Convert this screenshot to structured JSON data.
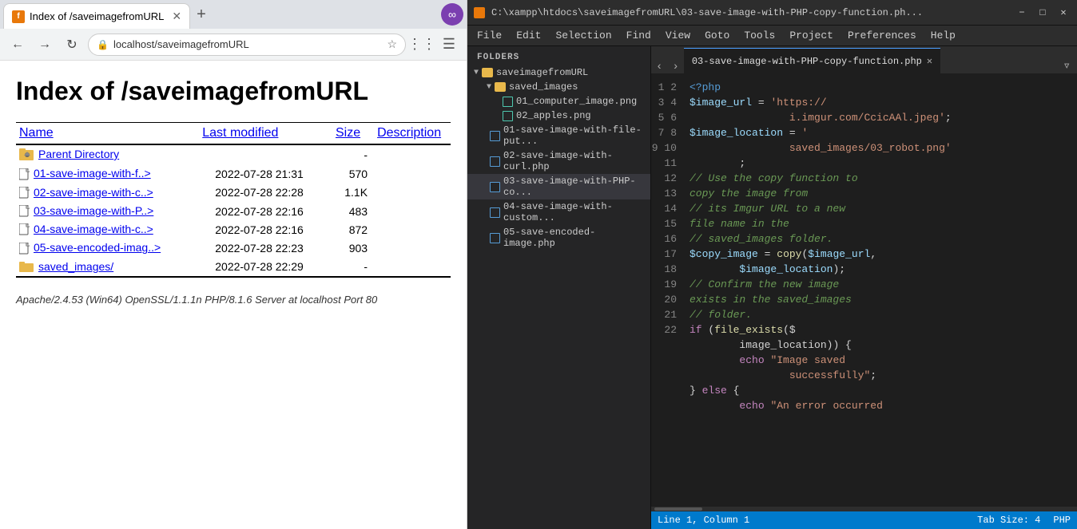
{
  "browser": {
    "tab_label": "Index of /saveimagefromURL",
    "favicon_letter": "f",
    "address": "localhost/saveimagefromURL",
    "page_title": "Index of /saveimagefromURL",
    "columns": {
      "name": "Name",
      "last_modified": "Last modified",
      "size": "Size",
      "description": "Description"
    },
    "entries": [
      {
        "name": "Parent Directory",
        "href": "#",
        "modified": "",
        "size": "-",
        "type": "parent"
      },
      {
        "name": "01-save-image-with-f..>",
        "href": "#",
        "modified": "2022-07-28 21:31",
        "size": "570",
        "type": "file"
      },
      {
        "name": "02-save-image-with-c..>",
        "href": "#",
        "modified": "2022-07-28 22:28",
        "size": "1.1K",
        "type": "file"
      },
      {
        "name": "03-save-image-with-P..>",
        "href": "#",
        "modified": "2022-07-28 22:16",
        "size": "483",
        "type": "file"
      },
      {
        "name": "04-save-image-with-c..>",
        "href": "#",
        "modified": "2022-07-28 22:16",
        "size": "872",
        "type": "file"
      },
      {
        "name": "05-save-encoded-imag..>",
        "href": "#",
        "modified": "2022-07-28 22:23",
        "size": "903",
        "type": "file"
      },
      {
        "name": "saved_images/",
        "href": "#",
        "modified": "2022-07-28 22:29",
        "size": "-",
        "type": "folder"
      }
    ],
    "footer": "Apache/2.4.53 (Win64) OpenSSL/1.1.1n PHP/8.1.6 Server at localhost Port 80"
  },
  "editor": {
    "titlebar": "C:\\xampp\\htdocs\\saveimagefromURL\\03-save-image-with-PHP-copy-function.ph...",
    "menus": [
      "File",
      "Edit",
      "Selection",
      "Find",
      "View",
      "Goto",
      "Tools",
      "Project",
      "Preferences",
      "Help"
    ],
    "folders_label": "FOLDERS",
    "tree": {
      "root": "saveimagefromURL",
      "subfolders": [
        {
          "name": "saved_images",
          "children": [
            {
              "name": "01_computer_image.png",
              "type": "image"
            },
            {
              "name": "02_apples.png",
              "type": "image"
            }
          ]
        }
      ],
      "files": [
        {
          "name": "01-save-image-with-file-put...",
          "type": "file",
          "active": false
        },
        {
          "name": "02-save-image-with-curl.php",
          "type": "file",
          "active": false
        },
        {
          "name": "03-save-image-with-PHP-co...",
          "type": "file",
          "active": true
        },
        {
          "name": "04-save-image-with-custom...",
          "type": "file",
          "active": false
        },
        {
          "name": "05-save-encoded-image.php",
          "type": "file",
          "active": false
        }
      ]
    },
    "active_tab": "03-save-image-with-PHP-copy-function.php",
    "statusbar": {
      "left": "Line 1, Column 1",
      "right": "Tab Size: 4",
      "language": "PHP"
    },
    "code_lines": [
      {
        "n": 1,
        "html": "<span class='tag'>&lt;?php</span>"
      },
      {
        "n": 2,
        "html": "<span class='var'>$image_url</span> <span class='op'>=</span> <span class='str'>'https://</span>"
      },
      {
        "n": 3,
        "html": "        <span class='str'>        i.imgur.com/CcicAAl.jpeg'</span><span class='op'>;</span>"
      },
      {
        "n": 4,
        "html": "<span class='var'>$image_location</span> <span class='op'>=</span> <span class='str'>'</span>"
      },
      {
        "n": 5,
        "html": "        <span class='str'>        saved_images/03_robot.png'</span>"
      },
      {
        "n": 6,
        "html": "        <span class='op'>;</span>"
      },
      {
        "n": 7,
        "html": "<span class='cm'>// Use the copy function to</span>"
      },
      {
        "n": 8,
        "html": "<span class='cm'>copy the image from</span>"
      },
      {
        "n": 9,
        "html": "<span class='cm'>// its Imgur URL to a new</span>"
      },
      {
        "n": 10,
        "html": "<span class='cm'>file name in the</span>"
      },
      {
        "n": 11,
        "html": "<span class='cm'>// saved_images folder.</span>"
      },
      {
        "n": 12,
        "html": "<span class='var'>$copy_image</span> <span class='op'>=</span> <span class='fn'>copy</span><span class='op'>(</span><span class='var'>$image_url</span><span class='op'>,</span>"
      },
      {
        "n": 13,
        "html": "        <span class='var'>$image_location</span><span class='op'>);</span>"
      },
      {
        "n": 14,
        "html": "<span class='cm'>// Confirm the new image</span>"
      },
      {
        "n": 15,
        "html": "<span class='cm'>exists in the saved_images</span>"
      },
      {
        "n": 16,
        "html": "<span class='cm'>// folder.</span>"
      },
      {
        "n": 17,
        "html": "<span class='kw'>if</span> <span class='op'>(</span><span class='fn'>file_exists</span><span class='op'>($</span>"
      },
      {
        "n": 18,
        "html": "        <span class='plain'>image_location)) {</span>"
      },
      {
        "n": 19,
        "html": "        <span class='kw'>echo</span> <span class='str'>\"Image saved</span>"
      },
      {
        "n": 20,
        "html": "                <span class='str'>successfully\"</span><span class='op'>;</span>"
      },
      {
        "n": 21,
        "html": "<span class='op'>}</span> <span class='kw'>else</span> <span class='op'>{</span>"
      },
      {
        "n": 22,
        "html": "        <span class='kw'>echo</span> <span class='str'>\"An error occurred</span>"
      }
    ]
  }
}
